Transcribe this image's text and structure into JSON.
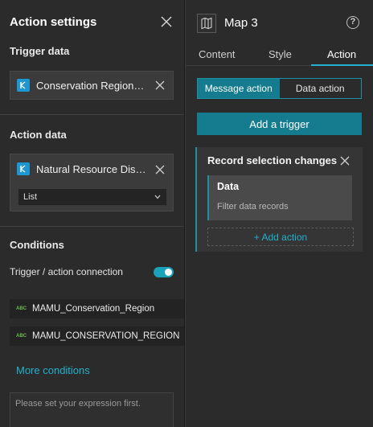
{
  "settings_panel": {
    "title": "Action settings",
    "trigger_data": {
      "heading": "Trigger data",
      "source_label": "Conservation Regions…"
    },
    "action_data": {
      "heading": "Action data",
      "source_label": "Natural Resource Dist…",
      "select_value": "List"
    },
    "conditions": {
      "heading": "Conditions",
      "toggle_label": "Trigger / action connection",
      "toggle_on": true,
      "fields": [
        {
          "type_badge": "ABC",
          "name": "MAMU_Conservation_Region"
        },
        {
          "type_badge": "ABC",
          "name": "MAMU_CONSERVATION_REGION"
        }
      ],
      "more_link": "More conditions",
      "expression_placeholder": "Please set your expression first."
    }
  },
  "widget_panel": {
    "title": "Map 3",
    "help_glyph": "?",
    "tabs": [
      {
        "label": "Content",
        "active": false
      },
      {
        "label": "Style",
        "active": false
      },
      {
        "label": "Action",
        "active": true
      }
    ],
    "segment": {
      "options": [
        "Message action",
        "Data action"
      ],
      "selected": "Message action"
    },
    "add_trigger_label": "Add a trigger",
    "trigger_card": {
      "title": "Record selection changes",
      "data_title": "Data",
      "data_subtitle": "Filter data records",
      "add_action_label": "+ Add action"
    }
  },
  "colors": {
    "accent": "#22b0cc",
    "accent_dark": "#147c8e",
    "panel_bg": "#2b2b2b",
    "datasource_icon": "#1e96d2",
    "field_type_green": "#6abf4b"
  }
}
